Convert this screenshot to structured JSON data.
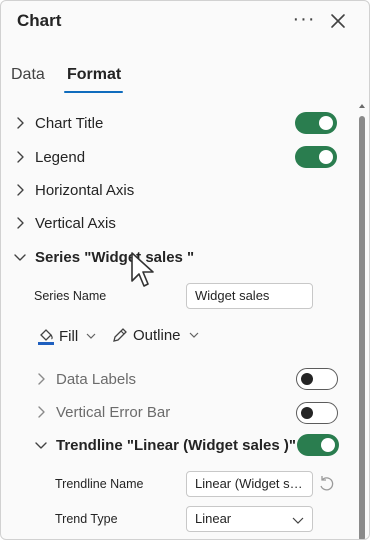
{
  "header": {
    "title": "Chart",
    "more_label": "···"
  },
  "tabs": [
    {
      "label": "Data",
      "active": false
    },
    {
      "label": "Format",
      "active": true
    }
  ],
  "sections": {
    "chart_title": {
      "label": "Chart Title",
      "enabled": true
    },
    "legend": {
      "label": "Legend",
      "enabled": true
    },
    "horizontal_axis": {
      "label": "Horizontal Axis"
    },
    "vertical_axis": {
      "label": "Vertical Axis"
    },
    "series": {
      "label": "Series \"Widget sales \"",
      "expanded": true
    }
  },
  "series_panel": {
    "series_name_label": "Series Name",
    "series_name_value": "Widget sales",
    "fill_label": "Fill",
    "outline_label": "Outline",
    "data_labels": {
      "label": "Data Labels",
      "enabled": false
    },
    "vertical_error_bar": {
      "label": "Vertical Error Bar",
      "enabled": false
    },
    "trendline": {
      "label": "Trendline \"Linear (Widget sales )\"",
      "enabled": true,
      "expanded": true
    },
    "trendline_name_label": "Trendline Name",
    "trendline_name_value": "Linear (Widget sa...",
    "trend_type_label": "Trend Type",
    "trend_type_value": "Linear"
  },
  "colors": {
    "accent": "#0f6cbd",
    "toggle_on": "#2a7d4f",
    "fill_swatch": "#1f5fbf"
  }
}
